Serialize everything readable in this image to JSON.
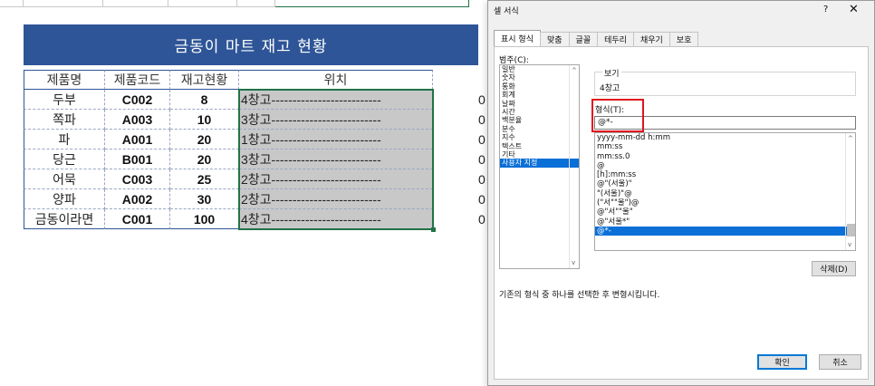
{
  "sheet": {
    "title": "금동이 마트 재고 현황",
    "headers": [
      "제품명",
      "제품코드",
      "재고현황",
      "위치"
    ],
    "rows": [
      {
        "name": "두부",
        "code": "C002",
        "stock": "8",
        "location": "4창고--------------------------",
        "extra": "0"
      },
      {
        "name": "쪽파",
        "code": "A003",
        "stock": "10",
        "location": "3창고--------------------------",
        "extra": "0"
      },
      {
        "name": "파",
        "code": "A001",
        "stock": "20",
        "location": "1창고--------------------------",
        "extra": "0"
      },
      {
        "name": "당근",
        "code": "B001",
        "stock": "20",
        "location": "3창고--------------------------",
        "extra": "0"
      },
      {
        "name": "어묵",
        "code": "C003",
        "stock": "25",
        "location": "2창고--------------------------",
        "extra": "0"
      },
      {
        "name": "양파",
        "code": "A002",
        "stock": "30",
        "location": "2창고--------------------------",
        "extra": "0"
      },
      {
        "name": "금동이라면",
        "code": "C001",
        "stock": "100",
        "location": "4창고--------------------------",
        "extra": "0"
      }
    ]
  },
  "dialog": {
    "title": "셀 서식",
    "help": "?",
    "close": "✕",
    "tabs": [
      "표시 형식",
      "맞춤",
      "글꼴",
      "테두리",
      "채우기",
      "보호"
    ],
    "category_label": "범주(C):",
    "categories": [
      "일반",
      "숫자",
      "통화",
      "회계",
      "날짜",
      "시간",
      "백분율",
      "분수",
      "지수",
      "텍스트",
      "기타",
      "사용자 지정"
    ],
    "selected_category": "사용자 지정",
    "preview_label": "보기",
    "preview_value": "4창고",
    "format_label": "형식(T):",
    "format_value": "@*-",
    "format_list": [
      "yyyy-mm-dd h:mm",
      "mm:ss",
      "mm:ss.0",
      "@",
      "[h]:mm:ss",
      "@\"(서울)\"",
      "\"(서울)\"@",
      "(\"서\"\"울\")@",
      "@\"서\"\"울\"",
      "@\"서울*\"",
      "@*-"
    ],
    "selected_format": "@*-",
    "delete_button": "삭제(D)",
    "hint": "기존의 형식 중 하나를 선택한 후 변형시킵니다.",
    "ok_button": "확인",
    "cancel_button": "취소"
  }
}
